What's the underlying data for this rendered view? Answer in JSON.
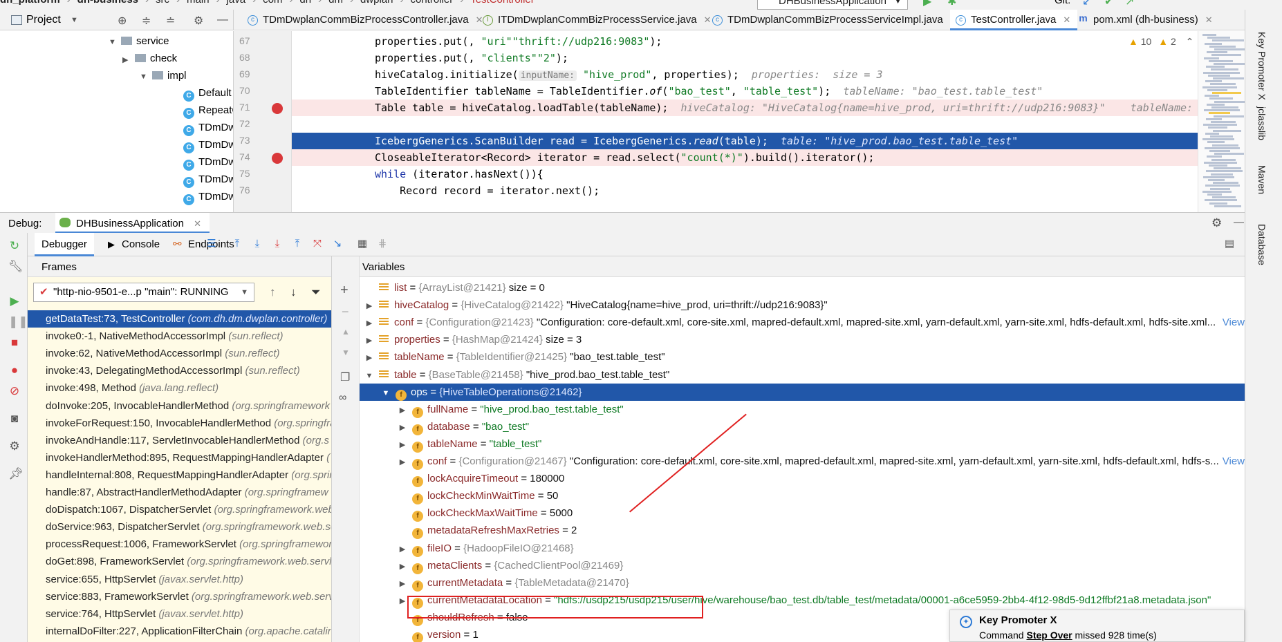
{
  "breadcrumb": {
    "items": [
      "dh_platform",
      "dh-business",
      "src",
      "main",
      "java",
      "com",
      "dh",
      "dm",
      "dwplan",
      "controller",
      "TestController"
    ],
    "run_config": "DHBusinessApplication",
    "git_label": "Git:"
  },
  "project_panel": {
    "title": "Project",
    "tree": [
      {
        "label": "service",
        "type": "folder",
        "expanded": true
      },
      {
        "label": "check",
        "type": "folder",
        "expanded": false
      },
      {
        "label": "impl",
        "type": "folder",
        "expanded": true
      },
      {
        "label": "Default",
        "type": "class"
      },
      {
        "label": "RepeatC",
        "type": "class"
      },
      {
        "label": "TDmDw",
        "type": "class"
      },
      {
        "label": "TDmDw",
        "type": "class"
      },
      {
        "label": "TDmDw",
        "type": "class"
      },
      {
        "label": "TDmDw",
        "type": "class"
      },
      {
        "label": "TDmDw",
        "type": "class"
      }
    ]
  },
  "editor_tabs": [
    {
      "label": "TDmDwplanCommBizProcessController.java",
      "icon": "class-icon",
      "active": false
    },
    {
      "label": "ITDmDwplanCommBizProcessService.java",
      "icon": "interface-icon",
      "active": false
    },
    {
      "label": "TDmDwplanCommBizProcessServiceImpl.java",
      "icon": "class-icon",
      "active": false
    },
    {
      "label": "TestController.java",
      "icon": "class-icon",
      "active": true
    },
    {
      "label": "pom.xml (dh-business)",
      "icon": "maven-icon",
      "active": false
    }
  ],
  "editor": {
    "warnings": "10",
    "weak_warnings": "2",
    "line_numbers": [
      "67",
      "68",
      "69",
      "70",
      "71",
      "72",
      "73",
      "74",
      "75",
      "76"
    ],
    "lines": [
      {
        "pre": "properties.put(",
        "s1": "\"uri\"",
        "mid": ", ",
        "s2": "\"thrift://udp216:9083\"",
        "post": ");"
      },
      {
        "pre": "properties.put(",
        "s1": "\"clients\"",
        "mid": ", ",
        "s2": "\"2\"",
        "post": ");"
      },
      {
        "pre": "hiveCatalog.initialize(",
        "ph": "inputName:",
        "s1": "\"hive_prod\"",
        "post": ", properties);",
        "hint": "properties:  size = 3"
      },
      {
        "pre": "TableIdentifier tableName = TableIdentifier.",
        "it": "of",
        "mid": "(",
        "s1": "\"bao_test\"",
        "mid2": ", ",
        "s2": "\"table_test\"",
        "post": ");",
        "hint": "tableName: \"bao_test.table_test\""
      },
      {
        "pre": "Table table = hiveCatalog.loadTable(tableName);",
        "hint": "hiveCatalog: \"HiveCatalog{name=hive_prod, uri=thrift://udp216:9083}\"    tableName: \"ba"
      },
      {
        "pre": ""
      },
      {
        "pre": "IcebergGenerics.ScanBuilder read = IcebergGenerics.",
        "it": "read",
        "post": "(table);",
        "hint": "table: \"hive_prod.bao_test.table_test\""
      },
      {
        "pre": "CloseableIterator<Record> iterator = read.select(",
        "s1": "\"count(*)\"",
        "post": ").build().iterator();"
      },
      {
        "kw": "while",
        "pre": " (iterator.hasNext()){"
      },
      {
        "pre": "    Record record = iterator.next();"
      }
    ]
  },
  "debug": {
    "label": "Debug:",
    "session": "DHBusinessApplication",
    "tabs": [
      "Debugger",
      "Console",
      "Endpoints"
    ],
    "frames_title": "Frames",
    "variables_title": "Variables",
    "thread": "\"http-nio-9501-e...p \"main\": RUNNING",
    "frames": [
      {
        "m": "getDataTest:73, TestController",
        "p": "(com.dh.dm.dwplan.controller)"
      },
      {
        "m": "invoke0:-1, NativeMethodAccessorImpl",
        "p": "(sun.reflect)"
      },
      {
        "m": "invoke:62, NativeMethodAccessorImpl",
        "p": "(sun.reflect)"
      },
      {
        "m": "invoke:43, DelegatingMethodAccessorImpl",
        "p": "(sun.reflect)"
      },
      {
        "m": "invoke:498, Method",
        "p": "(java.lang.reflect)"
      },
      {
        "m": "doInvoke:205, InvocableHandlerMethod",
        "p": "(org.springframework"
      },
      {
        "m": "invokeForRequest:150, InvocableHandlerMethod",
        "p": "(org.springfra"
      },
      {
        "m": "invokeAndHandle:117, ServletInvocableHandlerMethod",
        "p": "(org.s"
      },
      {
        "m": "invokeHandlerMethod:895, RequestMappingHandlerAdapter",
        "p": "("
      },
      {
        "m": "handleInternal:808, RequestMappingHandlerAdapter",
        "p": "(org.sprin"
      },
      {
        "m": "handle:87, AbstractHandlerMethodAdapter",
        "p": "(org.springframew"
      },
      {
        "m": "doDispatch:1067, DispatcherServlet",
        "p": "(org.springframework.web."
      },
      {
        "m": "doService:963, DispatcherServlet",
        "p": "(org.springframework.web.ser"
      },
      {
        "m": "processRequest:1006, FrameworkServlet",
        "p": "(org.springframework."
      },
      {
        "m": "doGet:898, FrameworkServlet",
        "p": "(org.springframework.web.servlet"
      },
      {
        "m": "service:655, HttpServlet",
        "p": "(javax.servlet.http)"
      },
      {
        "m": "service:883, FrameworkServlet",
        "p": "(org.springframework.web.servle"
      },
      {
        "m": "service:764, HttpServlet",
        "p": "(javax.servlet.http)"
      },
      {
        "m": "internalDoFilter:227, ApplicationFilterChain",
        "p": "(org.apache.catalin"
      }
    ],
    "variables": [
      {
        "n": "list",
        "t": "{ArrayList@21421}",
        "v": "size = 0",
        "icon": "list",
        "arrow": "",
        "indent": 0
      },
      {
        "n": "hiveCatalog",
        "t": "{HiveCatalog@21422}",
        "v": "\"HiveCatalog{name=hive_prod, uri=thrift://udp216:9083}\"",
        "icon": "list",
        "arrow": ">",
        "indent": 0
      },
      {
        "n": "conf",
        "t": "{Configuration@21423}",
        "v": "\"Configuration: core-default.xml, core-site.xml, mapred-default.xml, mapred-site.xml, yarn-default.xml, yarn-site.xml, hdfs-default.xml, hdfs-site.xml...",
        "view": "View",
        "icon": "list",
        "arrow": ">",
        "indent": 0
      },
      {
        "n": "properties",
        "t": "{HashMap@21424}",
        "v": "size = 3",
        "icon": "list",
        "arrow": ">",
        "indent": 0
      },
      {
        "n": "tableName",
        "t": "{TableIdentifier@21425}",
        "v": "\"bao_test.table_test\"",
        "icon": "list",
        "arrow": ">",
        "indent": 0
      },
      {
        "n": "table",
        "t": "{BaseTable@21458}",
        "v": "\"hive_prod.bao_test.table_test\"",
        "icon": "list",
        "arrow": "v",
        "indent": 0
      },
      {
        "n": "ops",
        "t": "{HiveTableOperations@21462}",
        "v": "",
        "icon": "f",
        "arrow": "v",
        "indent": 1,
        "selected": true
      },
      {
        "n": "fullName",
        "t": "",
        "sv": "\"hive_prod.bao_test.table_test\"",
        "icon": "f",
        "arrow": ">",
        "indent": 2
      },
      {
        "n": "database",
        "t": "",
        "sv": "\"bao_test\"",
        "icon": "f",
        "arrow": ">",
        "indent": 2
      },
      {
        "n": "tableName",
        "t": "",
        "sv": "\"table_test\"",
        "icon": "f",
        "arrow": ">",
        "indent": 2
      },
      {
        "n": "conf",
        "t": "{Configuration@21467}",
        "v": "\"Configuration: core-default.xml, core-site.xml, mapred-default.xml, mapred-site.xml, yarn-default.xml, yarn-site.xml, hdfs-default.xml, hdfs-s...",
        "view": "View",
        "icon": "f",
        "arrow": ">",
        "indent": 2
      },
      {
        "n": "lockAcquireTimeout",
        "t": "",
        "v": "180000",
        "icon": "f",
        "arrow": "",
        "indent": 2
      },
      {
        "n": "lockCheckMinWaitTime",
        "t": "",
        "v": "50",
        "icon": "f",
        "arrow": "",
        "indent": 2
      },
      {
        "n": "lockCheckMaxWaitTime",
        "t": "",
        "v": "5000",
        "icon": "f",
        "arrow": "",
        "indent": 2
      },
      {
        "n": "metadataRefreshMaxRetries",
        "t": "",
        "v": "2",
        "icon": "f",
        "arrow": "",
        "indent": 2
      },
      {
        "n": "fileIO",
        "t": "{HadoopFileIO@21468}",
        "v": "",
        "icon": "f",
        "arrow": ">",
        "indent": 2
      },
      {
        "n": "metaClients",
        "t": "{CachedClientPool@21469}",
        "v": "",
        "icon": "f",
        "arrow": ">",
        "indent": 2
      },
      {
        "n": "currentMetadata",
        "t": "{TableMetadata@21470}",
        "v": "",
        "icon": "f",
        "arrow": ">",
        "indent": 2
      },
      {
        "n": "currentMetadataLocation",
        "t": "",
        "sv": "\"hdfs://usdp215/usdp215/user/hive/warehouse/bao_test.db/table_test/metadata/00001-a6ce5959-2bb4-4f12-98d5-9d12ffbf21a8.metadata.json\"",
        "icon": "f",
        "arrow": ">",
        "indent": 2
      },
      {
        "n": "shouldRefresh",
        "t": "",
        "v": "false",
        "icon": "f",
        "arrow": "",
        "indent": 2
      },
      {
        "n": "version",
        "t": "",
        "v": "1",
        "icon": "f",
        "arrow": "",
        "indent": 2
      }
    ]
  },
  "right_strip": [
    "Key Promoter X",
    "jclasslib",
    "Maven",
    "Database"
  ],
  "notification": {
    "title": "Key Promoter X",
    "prefix": "Command",
    "command": "Step Over",
    "suffix": "missed 928 time(s)"
  },
  "colors": {
    "selection": "#2157a9",
    "breakpoint": "#d9383a",
    "annotation": "#e02020",
    "frames_bg": "#fffbe6"
  }
}
